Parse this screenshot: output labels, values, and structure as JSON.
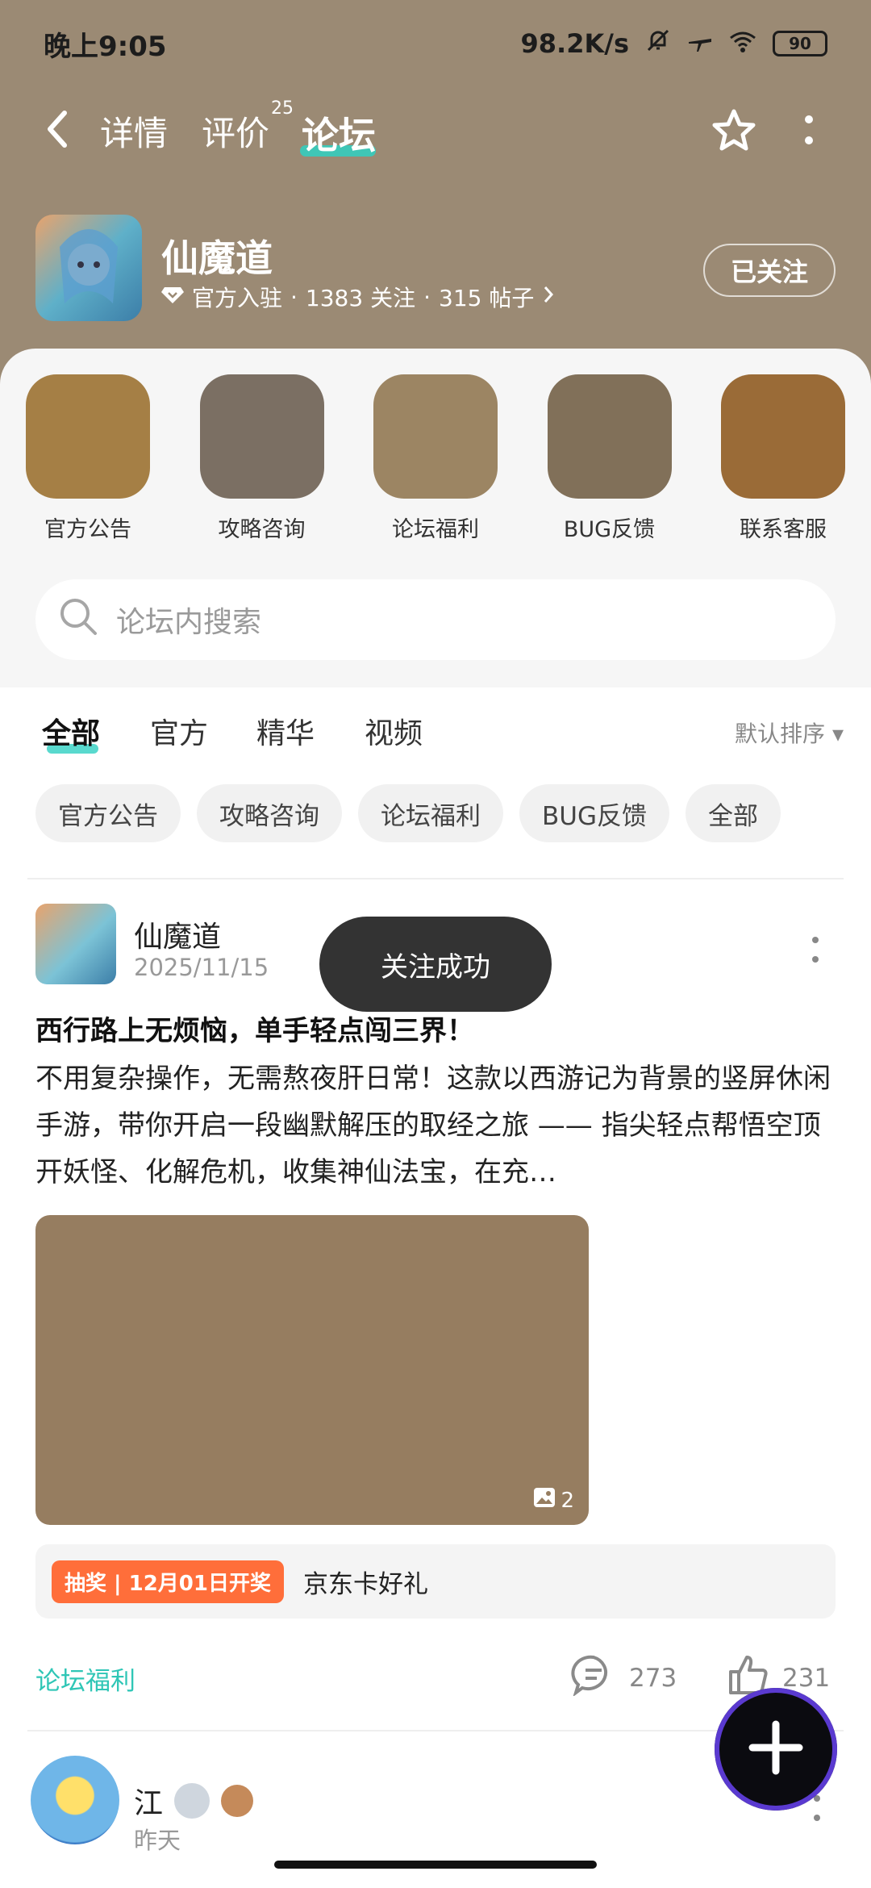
{
  "status_bar": {
    "time": "晚上9:05",
    "network_speed": "98.2K/s",
    "battery": "90"
  },
  "nav": {
    "tabs": [
      {
        "label": "详情"
      },
      {
        "label": "评价",
        "count": "25"
      },
      {
        "label": "论坛"
      }
    ],
    "active_tab": "论坛"
  },
  "game": {
    "name": "仙魔道",
    "official": "官方入驻",
    "followers": "1383 关注",
    "posts": "315 帖子",
    "follow_button": "已关注"
  },
  "quick_entries": [
    {
      "label": "官方公告",
      "color": "#a57f45"
    },
    {
      "label": "攻略咨询",
      "color": "#7b6f63"
    },
    {
      "label": "论坛福利",
      "color": "#9c8563"
    },
    {
      "label": "BUG反馈",
      "color": "#817059"
    },
    {
      "label": "联系客服",
      "color": "#9a6b37"
    }
  ],
  "search": {
    "placeholder": "论坛内搜索"
  },
  "feed_tabs": [
    "全部",
    "官方",
    "精华",
    "视频"
  ],
  "sort": "默认排序",
  "chips": [
    "官方公告",
    "攻略咨询",
    "论坛福利",
    "BUG反馈",
    "全部"
  ],
  "post": {
    "author": "仙魔道",
    "date": "2025/11/15",
    "title": "西行路上无烦恼，单手轻点闯三界！",
    "body": "不用复杂操作，无需熬夜肝日常！这款以西游记为背景的竖屏休闲手游，带你开启一段幽默解压的取经之旅 —— 指尖轻点帮悟空顶开妖怪、化解危机，收集神仙法宝，在充…",
    "image_count": "2",
    "lottery_badge": "抽奖 | 12月01日开奖",
    "lottery_text": "京东卡好礼",
    "category": "论坛福利",
    "comments": "273",
    "likes": "231"
  },
  "post2": {
    "author": "江",
    "date": "昨天"
  },
  "toast": "关注成功",
  "colors": {
    "accent": "#2fd0c2",
    "hero": "#9b8a74",
    "lottery": "#ff6e3a"
  }
}
